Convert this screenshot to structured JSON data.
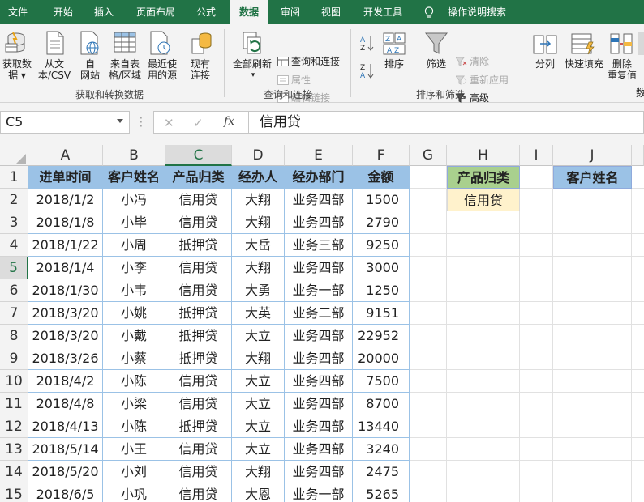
{
  "menu": {
    "tabs": [
      "文件",
      "开始",
      "插入",
      "页面布局",
      "公式",
      "数据",
      "审阅",
      "视图",
      "开发工具"
    ],
    "active_tab": "数据",
    "search": "操作说明搜索"
  },
  "ribbon": {
    "get_transform": {
      "get_data": "获取数\n据 ▾",
      "from_text": "从文\n本/CSV",
      "from_web": "自\n网站",
      "from_table": "来自表\n格/区域",
      "recent_sources": "最近使\n用的源",
      "existing_conn": "现有\n连接",
      "label": "获取和转换数据"
    },
    "queries": {
      "refresh_all": "全部刷新",
      "queries_conn": "查询和连接",
      "properties": "属性",
      "edit_links": "编辑链接",
      "label": "查询和连接"
    },
    "sort_filter": {
      "sort": "排序",
      "filter": "筛选",
      "clear": "清除",
      "reapply": "重新应用",
      "advanced": "高级",
      "label": "排序和筛选"
    },
    "data_tools": {
      "text_to_columns": "分列",
      "flash_fill": "快速填充",
      "remove_duplicates": "删除\n重复值",
      "label_partial": "数"
    }
  },
  "formula_bar": {
    "name_box": "C5",
    "formula": "信用贷",
    "cancel_glyph": "✕",
    "enter_glyph": "✓",
    "fx": "fx"
  },
  "grid": {
    "columns": [
      "A",
      "B",
      "C",
      "D",
      "E",
      "F",
      "G",
      "H",
      "I",
      "J"
    ],
    "selected_column": "C",
    "rows": [
      "1",
      "2",
      "3",
      "4",
      "5",
      "6",
      "7",
      "8",
      "9",
      "10",
      "11",
      "12",
      "13",
      "14",
      "15"
    ],
    "selected_row": "5",
    "headers": [
      "进单时间",
      "客户姓名",
      "产品归类",
      "经办人",
      "经办部门",
      "金额"
    ],
    "data": [
      [
        "2018/1/2",
        "小冯",
        "信用贷",
        "大翔",
        "业务四部",
        "1500"
      ],
      [
        "2018/1/8",
        "小毕",
        "信用贷",
        "大翔",
        "业务四部",
        "2790"
      ],
      [
        "2018/1/22",
        "小周",
        "抵押贷",
        "大岳",
        "业务三部",
        "9250"
      ],
      [
        "2018/1/4",
        "小李",
        "信用贷",
        "大翔",
        "业务四部",
        "3000"
      ],
      [
        "2018/1/30",
        "小韦",
        "信用贷",
        "大勇",
        "业务一部",
        "1250"
      ],
      [
        "2018/3/20",
        "小姚",
        "抵押贷",
        "大英",
        "业务二部",
        "9151"
      ],
      [
        "2018/3/20",
        "小戴",
        "抵押贷",
        "大立",
        "业务四部",
        "22952"
      ],
      [
        "2018/3/26",
        "小蔡",
        "抵押贷",
        "大翔",
        "业务四部",
        "20000"
      ],
      [
        "2018/4/2",
        "小陈",
        "信用贷",
        "大立",
        "业务四部",
        "7500"
      ],
      [
        "2018/4/8",
        "小梁",
        "信用贷",
        "大立",
        "业务四部",
        "8700"
      ],
      [
        "2018/4/13",
        "小陈",
        "抵押贷",
        "大立",
        "业务四部",
        "13440"
      ],
      [
        "2018/5/14",
        "小王",
        "信用贷",
        "大立",
        "业务四部",
        "3240"
      ],
      [
        "2018/5/20",
        "小刘",
        "信用贷",
        "大翔",
        "业务四部",
        "2475"
      ],
      [
        "2018/6/5",
        "小巩",
        "信用贷",
        "大恩",
        "业务一部",
        "5265"
      ]
    ],
    "criteria_header": "产品归类",
    "criteria_value": "信用贷",
    "output_header": "客户姓名"
  }
}
